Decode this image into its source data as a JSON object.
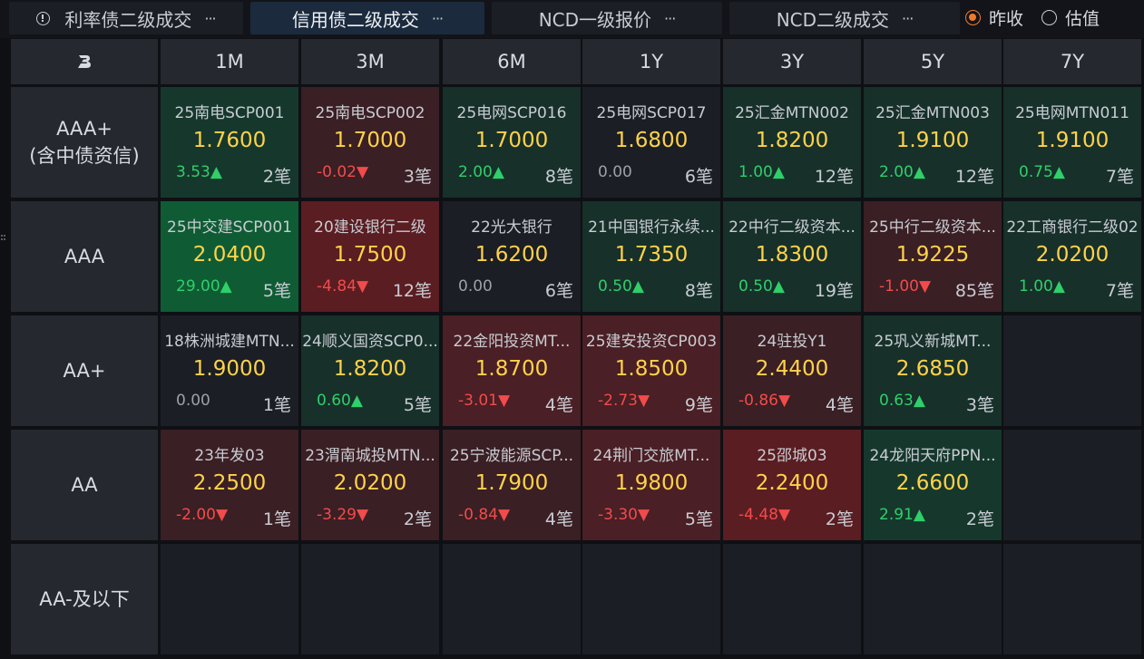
{
  "tabs": [
    {
      "label": "利率债二级成交",
      "more": "···",
      "active": false
    },
    {
      "label": "信用债二级成交",
      "more": "···",
      "active": true
    },
    {
      "label": "NCD一级报价",
      "more": "···",
      "active": false
    },
    {
      "label": "NCD二级成交",
      "more": "···",
      "active": false
    }
  ],
  "radios": [
    {
      "label": "昨收",
      "checked": true
    },
    {
      "label": "估值",
      "checked": false
    }
  ],
  "colors": {
    "accent_orange": "#f07a2c",
    "rate_yellow": "#ffd24a",
    "up_green": "#2fcf6a",
    "down_red": "#f24b4b"
  },
  "corner_logo": "B",
  "columns": [
    "1M",
    "3M",
    "6M",
    "1Y",
    "3Y",
    "5Y",
    "7Y"
  ],
  "rows": [
    {
      "label_lines": [
        "AAA+",
        "(含中债资信)"
      ],
      "cells": [
        {
          "name": "25南电SCP001",
          "rate": "1.7600",
          "chg": "3.53▲",
          "dir": "up",
          "count": "2笔",
          "tone": "green2"
        },
        {
          "name": "25南电SCP002",
          "rate": "1.7000",
          "chg": "-0.02▼",
          "dir": "down",
          "count": "3笔",
          "tone": "red1"
        },
        {
          "name": "25电网SCP016",
          "rate": "1.7000",
          "chg": "2.00▲",
          "dir": "up",
          "count": "8笔",
          "tone": "green1"
        },
        {
          "name": "25电网SCP017",
          "rate": "1.6800",
          "chg": "0.00",
          "dir": "flat",
          "count": "6笔",
          "tone": "neutral"
        },
        {
          "name": "25汇金MTN002",
          "rate": "1.8200",
          "chg": "1.00▲",
          "dir": "up",
          "count": "12笔",
          "tone": "green1"
        },
        {
          "name": "25汇金MTN003",
          "rate": "1.9100",
          "chg": "2.00▲",
          "dir": "up",
          "count": "12笔",
          "tone": "green1"
        },
        {
          "name": "25电网MTN011",
          "rate": "1.9100",
          "chg": "0.75▲",
          "dir": "up",
          "count": "7笔",
          "tone": "green1"
        }
      ]
    },
    {
      "label_lines": [
        "AAA"
      ],
      "cells": [
        {
          "name": "25中交建SCP001",
          "rate": "2.0400",
          "chg": "29.00▲",
          "dir": "up",
          "count": "5笔",
          "tone": "green3"
        },
        {
          "name": "20建设银行二级",
          "rate": "1.7500",
          "chg": "-4.84▼",
          "dir": "down",
          "count": "12笔",
          "tone": "red3"
        },
        {
          "name": "22光大银行",
          "rate": "1.6200",
          "chg": "0.00",
          "dir": "flat",
          "count": "6笔",
          "tone": "neutral"
        },
        {
          "name": "21中国银行永续...",
          "rate": "1.7350",
          "chg": "0.50▲",
          "dir": "up",
          "count": "8笔",
          "tone": "green1"
        },
        {
          "name": "22中行二级资本...",
          "rate": "1.8300",
          "chg": "0.50▲",
          "dir": "up",
          "count": "19笔",
          "tone": "green1"
        },
        {
          "name": "25中行二级资本...",
          "rate": "1.9225",
          "chg": "-1.00▼",
          "dir": "down",
          "count": "85笔",
          "tone": "red1"
        },
        {
          "name": "22工商银行二级02",
          "rate": "2.0200",
          "chg": "1.00▲",
          "dir": "up",
          "count": "7笔",
          "tone": "green1"
        }
      ]
    },
    {
      "label_lines": [
        "AA+"
      ],
      "cells": [
        {
          "name": "18株洲城建MTN...",
          "rate": "1.9000",
          "chg": "0.00",
          "dir": "flat",
          "count": "1笔",
          "tone": "neutral"
        },
        {
          "name": "24顺义国资SCP0...",
          "rate": "1.8200",
          "chg": "0.60▲",
          "dir": "up",
          "count": "5笔",
          "tone": "green1"
        },
        {
          "name": "22金阳投资MT...",
          "rate": "1.8700",
          "chg": "-3.01▼",
          "dir": "down",
          "count": "4笔",
          "tone": "red2"
        },
        {
          "name": "25建安投资CP003",
          "rate": "1.8500",
          "chg": "-2.73▼",
          "dir": "down",
          "count": "9笔",
          "tone": "red2"
        },
        {
          "name": "24驻投Y1",
          "rate": "2.4400",
          "chg": "-0.86▼",
          "dir": "down",
          "count": "4笔",
          "tone": "red1"
        },
        {
          "name": "25巩义新城MT...",
          "rate": "2.6850",
          "chg": "0.63▲",
          "dir": "up",
          "count": "3笔",
          "tone": "green1"
        },
        null
      ]
    },
    {
      "label_lines": [
        "AA"
      ],
      "cells": [
        {
          "name": "23年发03",
          "rate": "2.2500",
          "chg": "-2.00▼",
          "dir": "down",
          "count": "1笔",
          "tone": "red1"
        },
        {
          "name": "23渭南城投MTN...",
          "rate": "2.0200",
          "chg": "-3.29▼",
          "dir": "down",
          "count": "2笔",
          "tone": "red1"
        },
        {
          "name": "25宁波能源SCP...",
          "rate": "1.7900",
          "chg": "-0.84▼",
          "dir": "down",
          "count": "4笔",
          "tone": "red1"
        },
        {
          "name": "24荆门交旅MT...",
          "rate": "1.9800",
          "chg": "-3.30▼",
          "dir": "down",
          "count": "5笔",
          "tone": "red2"
        },
        {
          "name": "25邵城03",
          "rate": "2.2400",
          "chg": "-4.48▼",
          "dir": "down",
          "count": "2笔",
          "tone": "red3"
        },
        {
          "name": "24龙阳天府PPN...",
          "rate": "2.6600",
          "chg": "2.91▲",
          "dir": "up",
          "count": "2笔",
          "tone": "green2"
        },
        null
      ]
    },
    {
      "label_lines": [
        "AA-及以下"
      ],
      "cells": [
        null,
        null,
        null,
        null,
        null,
        null,
        null
      ]
    }
  ]
}
